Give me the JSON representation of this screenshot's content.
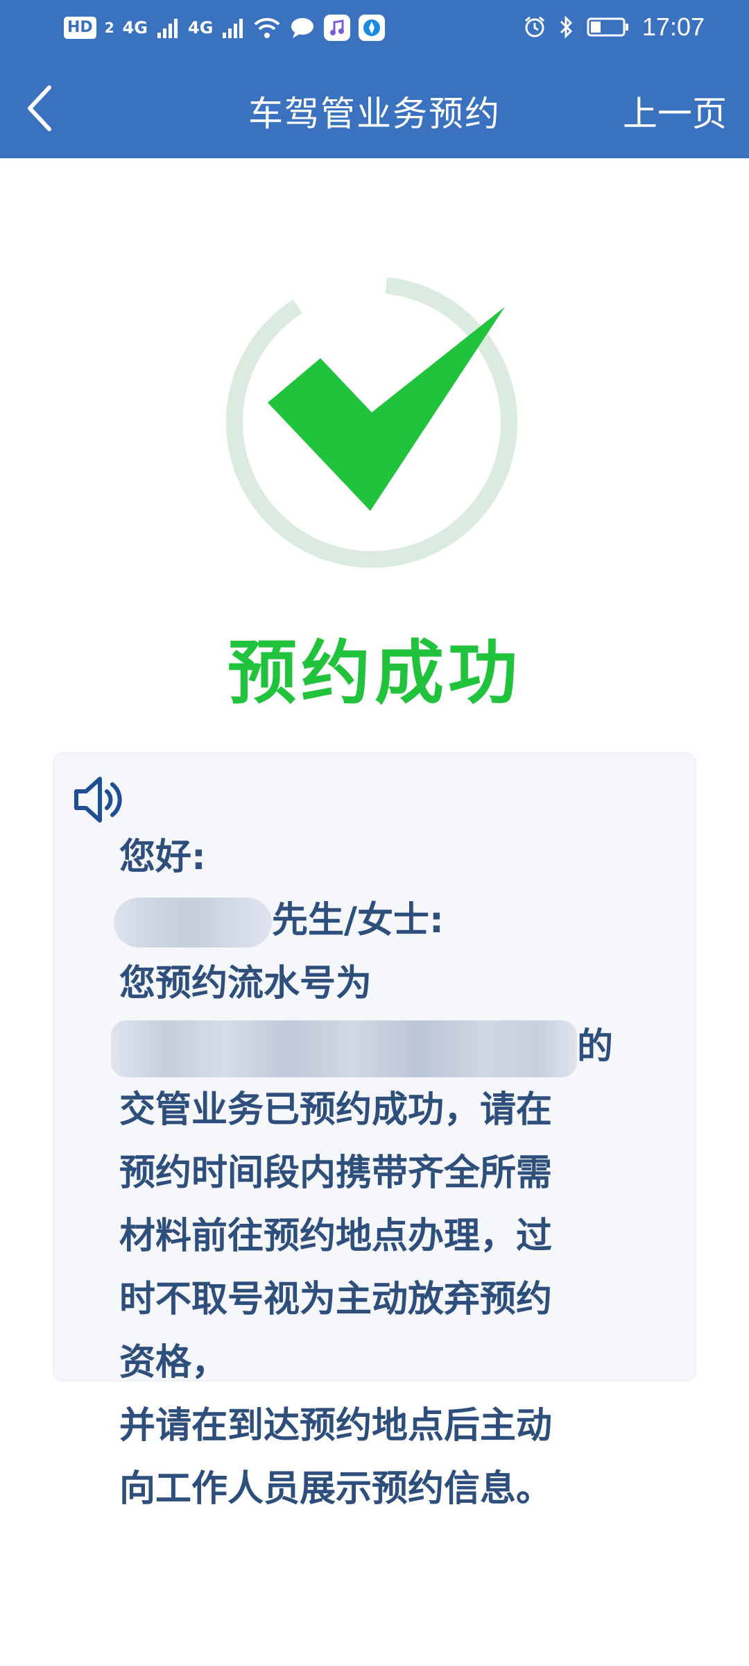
{
  "status_bar": {
    "hd_badge": "HD",
    "hd_sub": "2",
    "sim1": "4G",
    "sim2": "4G",
    "time": "17:07"
  },
  "nav": {
    "title": "车驾管业务预约",
    "prev_label": "上一页"
  },
  "result": {
    "title": "预约成功",
    "title_color": "#22c33c",
    "check_color": "#22c33c",
    "ring_color": "#dcebe0"
  },
  "message": {
    "greeting": "您好:",
    "name_suffix": "先生/女士:",
    "serial_prefix": "您预约流水号为",
    "serial_suffix": "的",
    "line_1": "交管业务已预约成功，请在",
    "line_2": "预约时间段内携带齐全所需",
    "line_3": "材料前往预约地点办理，过",
    "line_4": "时不取号视为主动放弃预约",
    "line_5": "资格，",
    "line_6": "并请在到达预约地点后主动",
    "line_7": "向工作人员展示预约信息。"
  },
  "colors": {
    "header_bg": "#3a72bf",
    "text": "#2e4e7c",
    "card_bg": "#f5f7fa"
  }
}
